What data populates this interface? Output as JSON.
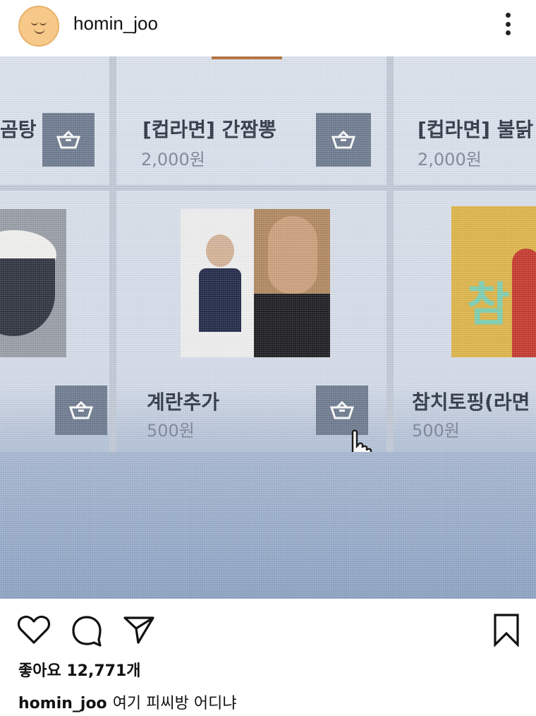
{
  "header": {
    "username": "homin_joo",
    "avatar_icon": "sleepy-face-icon",
    "more_icon": "more-vertical-icon"
  },
  "photo": {
    "top_row": [
      {
        "name": "곰탕",
        "cart_icon": "cart-icon"
      },
      {
        "name": "[컵라면] 간짬뽕",
        "price": "2,000원",
        "cart_icon": "cart-icon"
      },
      {
        "name": "[컵라면] 불닭",
        "price": "2,000원"
      }
    ],
    "bottom_row": [
      {
        "cart_icon": "cart-icon"
      },
      {
        "name": "계란추가",
        "price": "500원",
        "cart_icon": "cart-icon"
      },
      {
        "name": "참치토핑(라면",
        "price": "500원",
        "logo_text": "참"
      }
    ],
    "cursor_icon": "hand-pointer-icon"
  },
  "actions": {
    "like_icon": "heart-icon",
    "comment_icon": "comment-icon",
    "share_icon": "send-icon",
    "save_icon": "bookmark-icon"
  },
  "likes": {
    "text": "좋아요 12,771개"
  },
  "caption": {
    "username": "homin_joo",
    "text": "여기 피씨방 어디냐"
  },
  "colors": {
    "accent": "#6f7c91",
    "screen_bg": "#dfe6f1",
    "text_dark": "#2f3745",
    "price_gray": "#7e8798"
  }
}
